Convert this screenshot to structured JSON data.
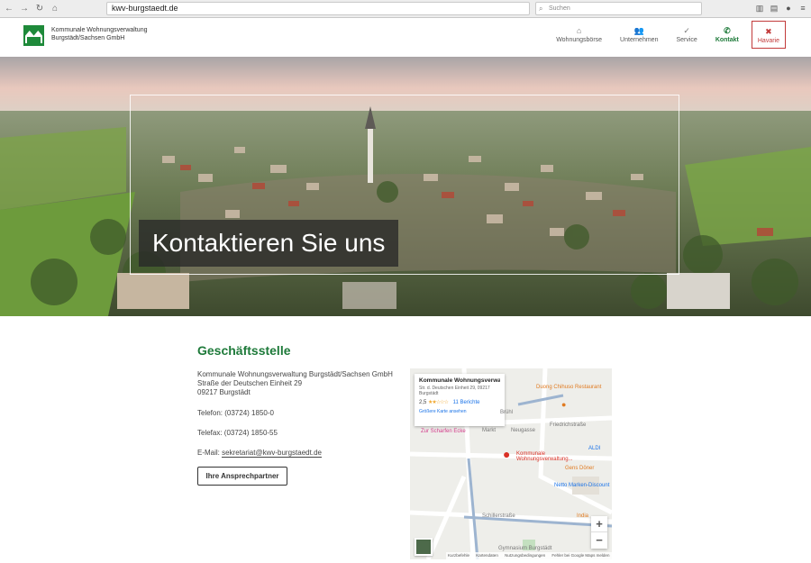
{
  "browser": {
    "url": "kwv-burgstaedt.de",
    "search_placeholder": "Suchen"
  },
  "header": {
    "brand_line1": "Kommunale Wohnungsverwaltung",
    "brand_line2": "Burgstädt/Sachsen GmbH",
    "nav": [
      {
        "label": "Wohnungsbörse",
        "icon": "home-circle-icon"
      },
      {
        "label": "Unternehmen",
        "icon": "people-icon"
      },
      {
        "label": "Service",
        "icon": "check-circle-icon"
      },
      {
        "label": "Kontakt",
        "icon": "phone-icon"
      },
      {
        "label": "Havarie",
        "icon": "tools-icon"
      }
    ]
  },
  "hero": {
    "title": "Kontaktieren Sie uns"
  },
  "office": {
    "title": "Geschäftsstelle",
    "company": "Kommunale Wohnungsverwaltung Burgstädt/Sachsen GmbH",
    "street": "Straße der Deutschen Einheit 29",
    "city": "09217 Burgstädt",
    "phone": "Telefon: (03724) 1850-0",
    "fax": "Telefax: (03724) 1850-55",
    "email_label": "E-Mail:",
    "email": "sekretariat@kwv-burgstaedt.de",
    "button_label": "Ihre Ansprechpartner"
  },
  "map": {
    "info_title": "Kommunale Wohnungsverwal...",
    "info_address": "Str. d. Deutschen Einheit 29, 09217 Burgstädt",
    "rating": "2,5",
    "stars": "★★☆☆☆",
    "reviews": "11 Berichte",
    "larger_map": "Größere Karte ansehen",
    "labels": {
      "restaurant": "Duong Chihuso Restaurant",
      "marker": "Kommunale Wohnungsverwaltung...",
      "cafe": "Zur Scharfen Ecke",
      "doner": "Gens Döner",
      "netto": "Netto Marken-Discount",
      "aldi": "ALDI",
      "india": "India",
      "street1": "Friedrichstraße",
      "street2": "Schillerstraße",
      "street3": "Neugasse",
      "street4": "Markt",
      "street5": "Brühl",
      "gym": "Gymnasium Burgstädt",
      "google": "Google"
    },
    "zoom_in": "+",
    "zoom_out": "−",
    "footer": [
      "Kurzbefehle",
      "Kartendaten",
      "Nutzungsbedingungen",
      "Fehler bei Google Maps melden"
    ]
  }
}
